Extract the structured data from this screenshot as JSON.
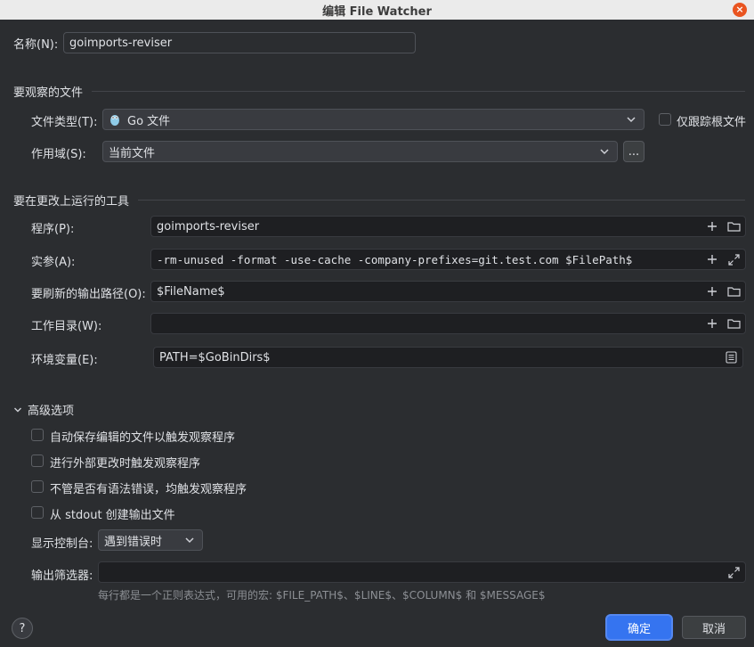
{
  "window": {
    "title": "编辑 File Watcher",
    "close_glyph": "×"
  },
  "name": {
    "label": "名称(N):",
    "value": "goimports-reviser"
  },
  "watched_files": {
    "section_title": "要观察的文件",
    "file_type": {
      "label": "文件类型(T):",
      "value": "Go 文件",
      "icon": "gopher-icon"
    },
    "track_root_only": {
      "label": "仅跟踪根文件",
      "checked": false
    },
    "scope": {
      "label": "作用域(S):",
      "value": "当前文件",
      "browse_label": "..."
    }
  },
  "tool": {
    "section_title": "要在更改上运行的工具",
    "program": {
      "label": "程序(P):",
      "value": "goimports-reviser"
    },
    "arguments": {
      "label": "实参(A):",
      "value": "-rm-unused -format -use-cache -company-prefixes=git.test.com $FilePath$"
    },
    "output_paths": {
      "label": "要刷新的输出路径(O):",
      "value": "$FileName$"
    },
    "working_dir": {
      "label": "工作目录(W):",
      "value": ""
    },
    "env_vars": {
      "label": "环境变量(E):",
      "value": "PATH=$GoBinDirs$"
    }
  },
  "advanced": {
    "section_title": "高级选项",
    "options": [
      {
        "label": "自动保存编辑的文件以触发观察程序",
        "checked": false
      },
      {
        "label": "进行外部更改时触发观察程序",
        "checked": false
      },
      {
        "label": "不管是否有语法错误，均触发观察程序",
        "checked": false
      },
      {
        "label": "从 stdout 创建输出文件",
        "checked": false
      }
    ],
    "show_console": {
      "label": "显示控制台:",
      "value": "遇到错误时"
    },
    "output_filters": {
      "label": "输出筛选器:",
      "value": "",
      "hint": "每行都是一个正则表达式，可用的宏: $FILE_PATH$、$LINE$、$COLUMN$ 和 $MESSAGE$"
    }
  },
  "footer": {
    "help_label": "?",
    "ok_label": "确定",
    "cancel_label": "取消"
  },
  "colors": {
    "accent": "#3574f0",
    "background": "#2b2d30",
    "field": "#1e1f22"
  }
}
